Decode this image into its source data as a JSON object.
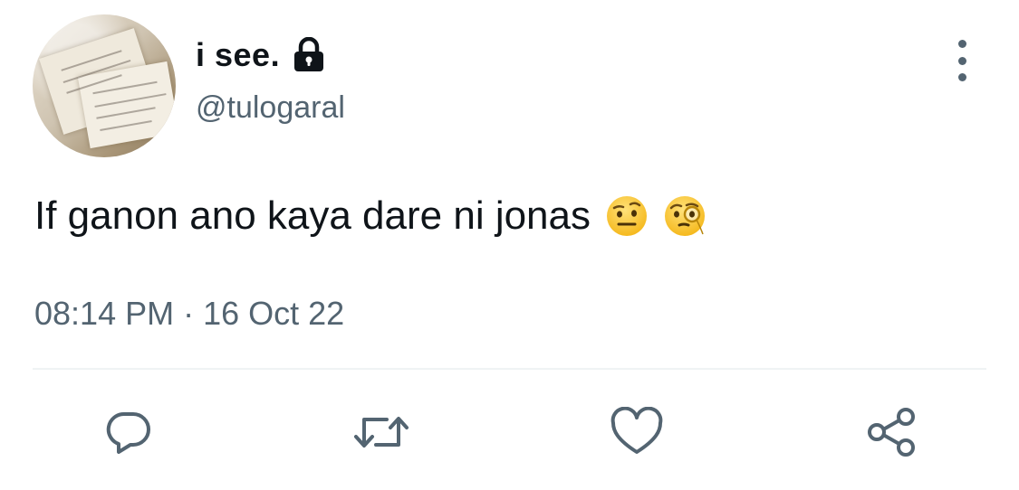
{
  "tweet": {
    "display_name": "i see.",
    "handle": "@tulogaral",
    "protected_icon": "lock-icon",
    "menu_icon": "more-vertical-icon",
    "text": "If ganon ano kaya dare ni jonas",
    "emojis": [
      "face-with-raised-eyebrow",
      "face-with-monocle"
    ],
    "time": "08:14 PM",
    "separator": "·",
    "date": "16 Oct 22"
  },
  "actions": {
    "reply_icon": "reply-icon",
    "retweet_icon": "retweet-icon",
    "like_icon": "heart-icon",
    "share_icon": "share-icon"
  },
  "colors": {
    "text_primary": "#0f1419",
    "text_secondary": "#536471",
    "divider": "#eff3f4",
    "background": "#ffffff"
  }
}
